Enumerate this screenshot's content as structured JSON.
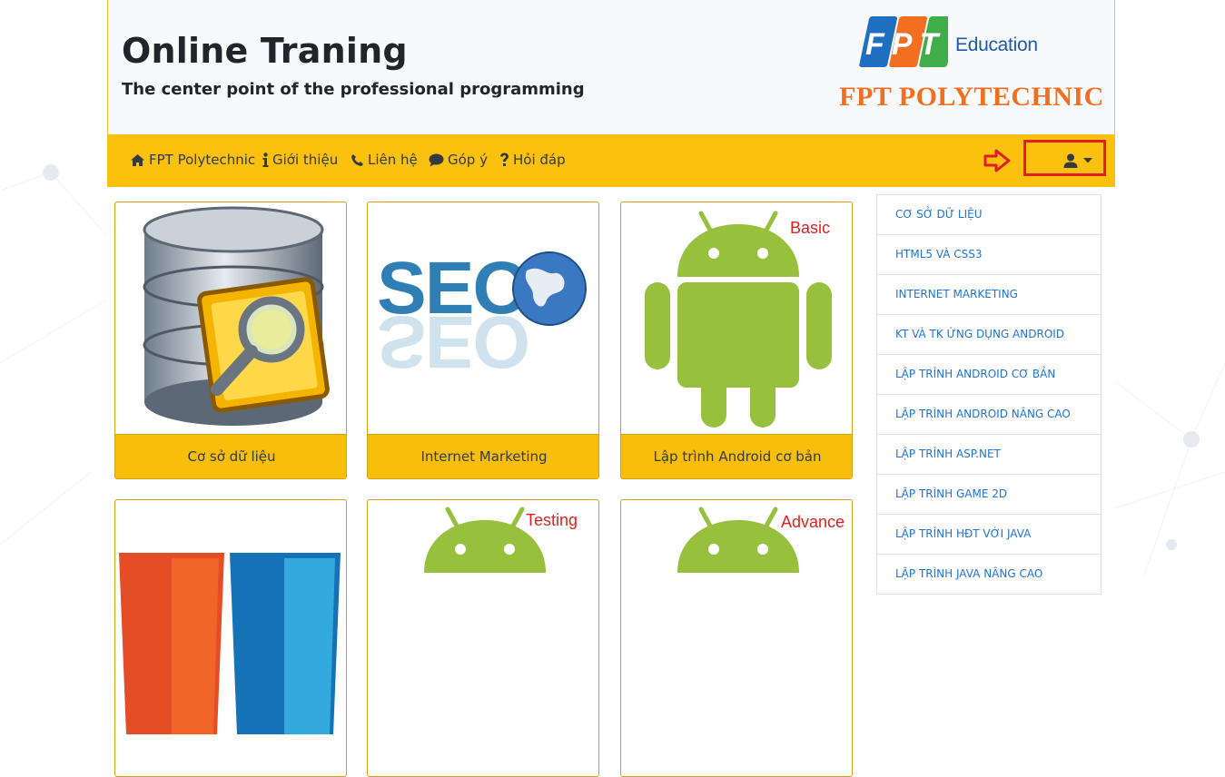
{
  "header": {
    "title": "Online Traning",
    "subtitle": "The center point of the professional programming",
    "logo": {
      "brand": "FPT",
      "education": "Education",
      "polytechnic": "FPT POLYTECHNIC"
    }
  },
  "nav": {
    "items": [
      {
        "label": "FPT Polytechnic",
        "icon": "home-icon"
      },
      {
        "label": "Giới thiệu",
        "icon": "info-icon"
      },
      {
        "label": "Liên hệ",
        "icon": "phone-icon"
      },
      {
        "label": "Góp ý",
        "icon": "comment-icon"
      },
      {
        "label": "Hỏi đáp",
        "icon": "question-icon"
      }
    ],
    "user_menu_icon": "user-icon"
  },
  "cards": [
    {
      "title": "Cơ sở dữ liệu",
      "icon": "database-search-icon"
    },
    {
      "title": "Internet Marketing",
      "icon": "seo-globe-icon"
    },
    {
      "title": "Lập trình Android cơ bản",
      "icon": "android-icon",
      "badge": "Basic"
    },
    {
      "title": "",
      "icon": "html5-css3-icon"
    },
    {
      "title": "",
      "icon": "android-icon",
      "badge": "Testing"
    },
    {
      "title": "",
      "icon": "android-icon",
      "badge": "Advance"
    }
  ],
  "sidebar": {
    "items": [
      "CƠ SỞ DỮ LIỆU",
      "HTML5 VÀ CSS3",
      "INTERNET MARKETING",
      "KT VÀ TK ỨNG DỤNG ANDROID",
      "LẬP TRÌNH ANDROID CƠ BẢN",
      "LẬP TRÌNH ANDROID NÂNG CAO",
      "LẬP TRÌNH ASP.NET",
      "LẬP TRÌNH GAME 2D",
      "LẬP TRÌNH HĐT VỚI JAVA",
      "LẬP TRÌNH JAVA NÂNG CAO"
    ]
  },
  "colors": {
    "navbar": "#fcc10e",
    "card_footer": "#f7bf0c",
    "link": "#1e73d8",
    "highlight": "#e51c23",
    "android": "#97c03d"
  }
}
